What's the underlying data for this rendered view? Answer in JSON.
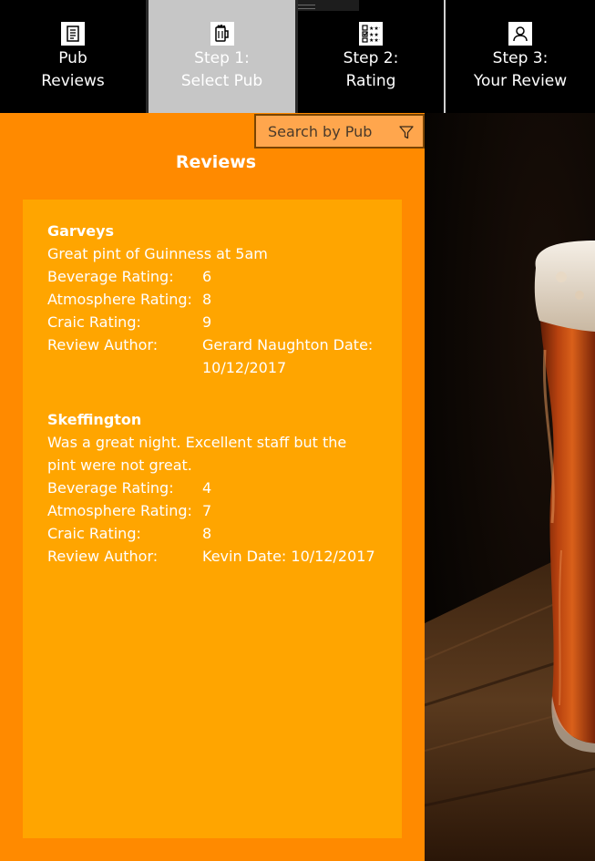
{
  "nav": {
    "items": [
      {
        "line1": "Pub",
        "line2": "Reviews",
        "icon": "document-icon"
      },
      {
        "line1": "Step 1:",
        "line2": "Select Pub",
        "icon": "beer-mug-icon",
        "active": true
      },
      {
        "line1": "Step 2:",
        "line2": "Rating",
        "icon": "rating-checklist-icon"
      },
      {
        "line1": "Step 3:",
        "line2": "Your Review",
        "icon": "user-icon"
      }
    ]
  },
  "search": {
    "placeholder": "Search by Pub",
    "icon": "filter-icon"
  },
  "heading": "Reviews",
  "labels": {
    "beverage": "Beverage Rating:",
    "atmosphere": "Atmosphere Rating:",
    "craic": "Craic Rating:",
    "author": "Review Author:"
  },
  "reviews": [
    {
      "pub": "Garveys",
      "comment": "Great pint of Guinness at 5am",
      "beverage": "6",
      "atmosphere": "8",
      "craic": "9",
      "author": "Gerard Naughton Date: 10/12/2017"
    },
    {
      "pub": "Skeffington",
      "comment": "Was a great night. Excellent staff but the pint were not great.",
      "beverage": "4",
      "atmosphere": "7",
      "craic": "8",
      "author": "Kevin Date: 10/12/2017"
    }
  ],
  "colors": {
    "accent": "#ff8a00",
    "card": "#ffa500",
    "nav_active": "#c6c6c6"
  }
}
